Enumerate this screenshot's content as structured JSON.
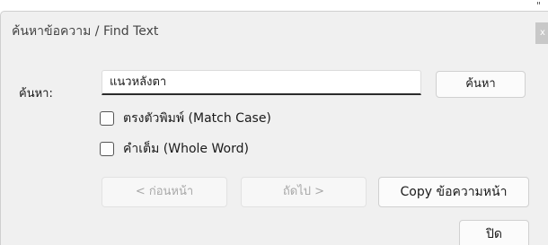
{
  "corner_mark": "\"",
  "dialog": {
    "title": "ค้นหาข้อความ / Find Text",
    "close_glyph": "x"
  },
  "search": {
    "label": "ค้นหา:",
    "value": "แนวหลังตา",
    "button": "ค้นหา"
  },
  "options": {
    "match_case": {
      "label": "ตรงตัวพิมพ์ (Match Case)",
      "checked": false
    },
    "whole_word": {
      "label": "คำเต็ม (Whole Word)",
      "checked": false
    }
  },
  "navigation": {
    "previous": "< ก่อนหน้า",
    "next": "ถัดไป >",
    "copy": "Copy ข้อความหน้า"
  },
  "footer": {
    "close": "ปิด"
  }
}
